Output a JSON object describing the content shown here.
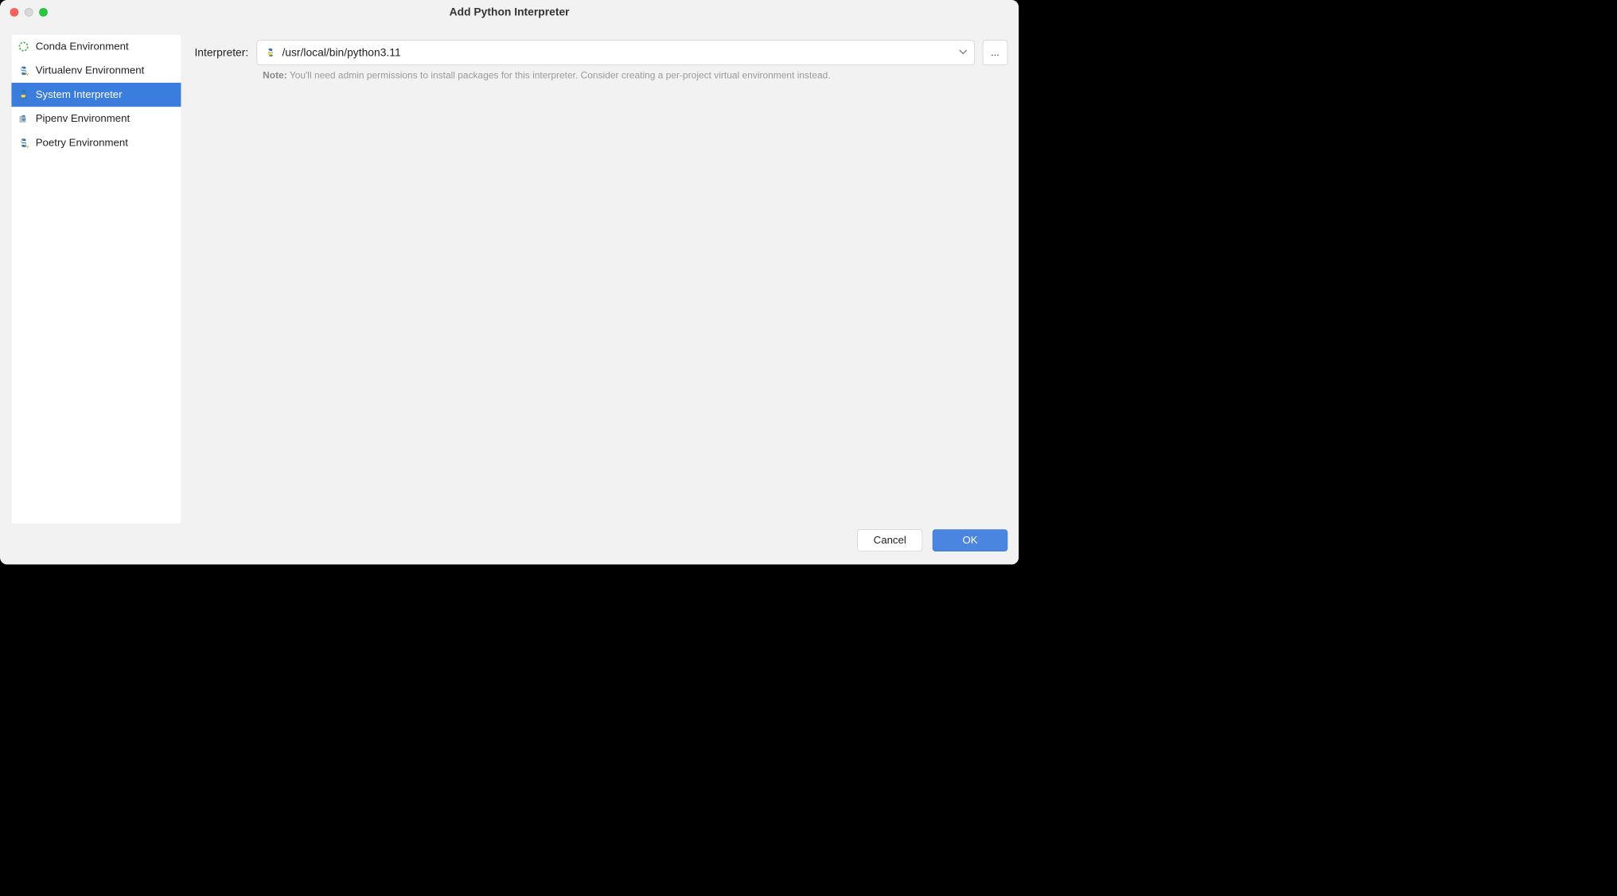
{
  "window": {
    "title": "Add Python Interpreter"
  },
  "sidebar": {
    "items": [
      {
        "label": "Conda Environment",
        "icon": "conda-icon"
      },
      {
        "label": "Virtualenv Environment",
        "icon": "python-venv-icon"
      },
      {
        "label": "System Interpreter",
        "icon": "python-icon"
      },
      {
        "label": "Pipenv Environment",
        "icon": "pipenv-icon"
      },
      {
        "label": "Poetry Environment",
        "icon": "poetry-icon"
      }
    ],
    "selected_index": 2
  },
  "form": {
    "interpreter_label": "Interpreter:",
    "interpreter_value": "/usr/local/bin/python3.11",
    "browse_label": "...",
    "note_bold": "Note:",
    "note_text": "You'll need admin permissions to install packages for this interpreter. Consider creating a per-project virtual environment instead."
  },
  "footer": {
    "cancel": "Cancel",
    "ok": "OK"
  }
}
